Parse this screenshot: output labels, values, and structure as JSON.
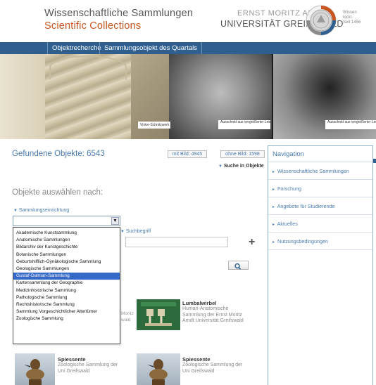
{
  "header": {
    "title_de": "Wissenschaftliche Sammlungen",
    "title_en": "Scientific Collections",
    "university_line1": "ERNST MORITZ ARNDT",
    "university_line2": "UNIVERSITÄT GREIFSWALD",
    "seal_text_line1": "Wissen",
    "seal_text_line2": "lockt.",
    "seal_text_line3": "Seit 1456"
  },
  "nav": {
    "tabs": [
      {
        "label": "Objektrecherche"
      },
      {
        "label": "Sammlungsobjekt des Quartals"
      }
    ]
  },
  "banner": {
    "captions": [
      "Vistor-Schnitzwerk Sammlung",
      "Ausschnitt aus vergrößerter Lebertiss",
      "Ausschnitt aus vergrößerter Lebertiss"
    ]
  },
  "results": {
    "found_label": "Gefundene Objekte: 6543",
    "with_image": "mit Bild: 4945",
    "without_image": "ohne Bild: 1598",
    "search_in_objects": "Suche in Objekte"
  },
  "selection": {
    "heading": "Objekte auswählen nach:",
    "einrichtung_label": "Sammlungseinrichtung",
    "selected_value": "",
    "suchbegriff_label": "Suchbegriff",
    "suchbegriff_value": "",
    "options": [
      "Akademische Kunstsammlung",
      "Anatomische Sammlungen",
      "Bildarchiv der Kunstgeschichte",
      "Botanische Sammlungen",
      "Geburtshilflich-Gynäkologische Sammlung",
      "Geologische Sammlungen",
      "Gustaf-Dalman-Sammlung",
      "Kartensammlung der Geographie",
      "Medizinhistorische Sammlung",
      "Pathologische Sammlung",
      "Rechtshistorische Sammlung",
      "Sammlung Vorgeschichtlicher Altertümer",
      "Zoologische Sammlung"
    ],
    "highlighted_option_index": 6
  },
  "cards": [
    {
      "title": "Lumbalwirbel",
      "desc": "Human-Anatomische Sammlung der Ernst Moritz Arndt Universität Greifswald"
    },
    {
      "title": "Spiessente",
      "desc": "Zoologische Sammlung der Uni Greifswald"
    },
    {
      "title": "Spiessente",
      "desc": "Zoologische Sammlung der Uni Greifswald"
    }
  ],
  "card_peek": "Moritz\nwald",
  "sidebar": {
    "heading": "Navigation",
    "items": [
      {
        "label": "Wissenschaftliche Sammlungen"
      },
      {
        "label": "Forschung"
      },
      {
        "label": "Angebote für Studierende"
      },
      {
        "label": "Aktuelles"
      },
      {
        "label": "Nutzungsbedingungen"
      }
    ]
  },
  "colors": {
    "brand_blue": "#2e5f8e",
    "link_blue": "#4a7bb0",
    "title_orange": "#c8541e",
    "selection_blue": "#3569c7"
  }
}
